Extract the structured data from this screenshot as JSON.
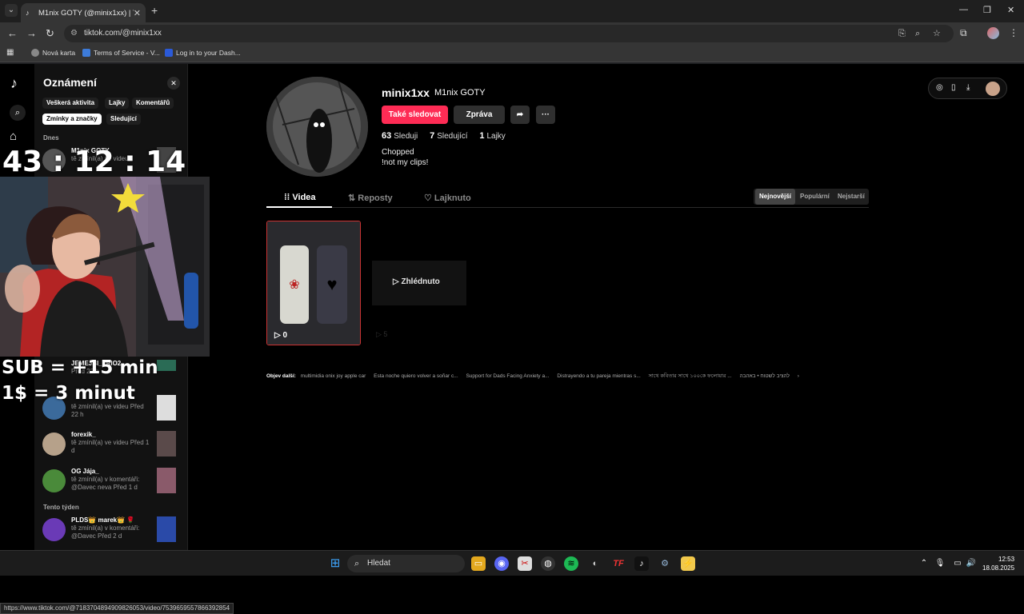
{
  "browser": {
    "tab_title": "M1nix GOTY (@minix1xx) | TikTok",
    "url": "tiktok.com/@minix1xx",
    "bookmarks": [
      "Nová karta",
      "Terms of Service - V...",
      "Log in to your Dash..."
    ],
    "status_url": "https://www.tiktok.com/@7183704894909826053/video/7539659557866392854"
  },
  "notifications": {
    "title": "Oznámení",
    "chips": [
      "Veškerá aktivita",
      "Lajky",
      "Komentářů",
      "Zmínky a značky",
      "Sledující"
    ],
    "active_chip": "Zmínky a značky",
    "section_today": "Dnes",
    "section_week": "Tento týden",
    "items": [
      {
        "name": "M1nix GOTY",
        "text": "tě zmínil(a) ve videu"
      },
      {
        "name": "JEMEJBI_TRIO2",
        "text": "Před 22 h"
      },
      {
        "name": "",
        "text": "tě zmínil(a) ve videu Před 22 h"
      },
      {
        "name": "forexik_",
        "text": "tě zmínil(a) ve videu Před 1 d"
      },
      {
        "name": "OG Jája_",
        "text": "tě zmínil(a) v komentáři: @Davec neva Před 1 d"
      },
      {
        "name": "PLDS👑 marek👑 🌹",
        "text": "tě zmínil(a) v komentáři: @Davec Před 2 d"
      }
    ]
  },
  "overlay": {
    "timer": "43 : 12 : 14",
    "sub_line": "SUB = +15 min",
    "dollar_line": "1$ = 3 minut"
  },
  "profile": {
    "username": "minix1xx",
    "display_name": "M1nix GOTY",
    "follow_label": "Také sledovat",
    "message_label": "Zpráva",
    "following_count": "63",
    "following_label": "Sleduji",
    "followers_count": "7",
    "followers_label": "Sledující",
    "likes_count": "1",
    "likes_label": "Lajky",
    "bio_line1": "Chopped",
    "bio_line2": "!not my clips!",
    "tabs": [
      "Videa",
      "Reposty",
      "Lajknuto"
    ],
    "sort": [
      "Nejnovější",
      "Populární",
      "Nejstarší"
    ],
    "videos": [
      {
        "views": "0"
      },
      {
        "views": "5",
        "overlay": "Zhlédnuto"
      }
    ],
    "explore_label": "Objev další:",
    "explore_items": [
      "multimidia onix joy apple car",
      "Esta noche quiero volver a soñar c...",
      "Support for Dads Facing Anxiety a...",
      "Distrayendo a tu pareja mientras s...",
      "সাথে কবিতার সাথে ১০০কে ফলোয়ার ...",
      "להציב לשטוח • באהבה"
    ]
  },
  "taskbar": {
    "search": "Hledat",
    "time": "12:53",
    "date": "18.08.2025"
  },
  "colors": {
    "accent": "#fe2c55",
    "page_bg": "#000000",
    "panel_bg": "#121212"
  }
}
